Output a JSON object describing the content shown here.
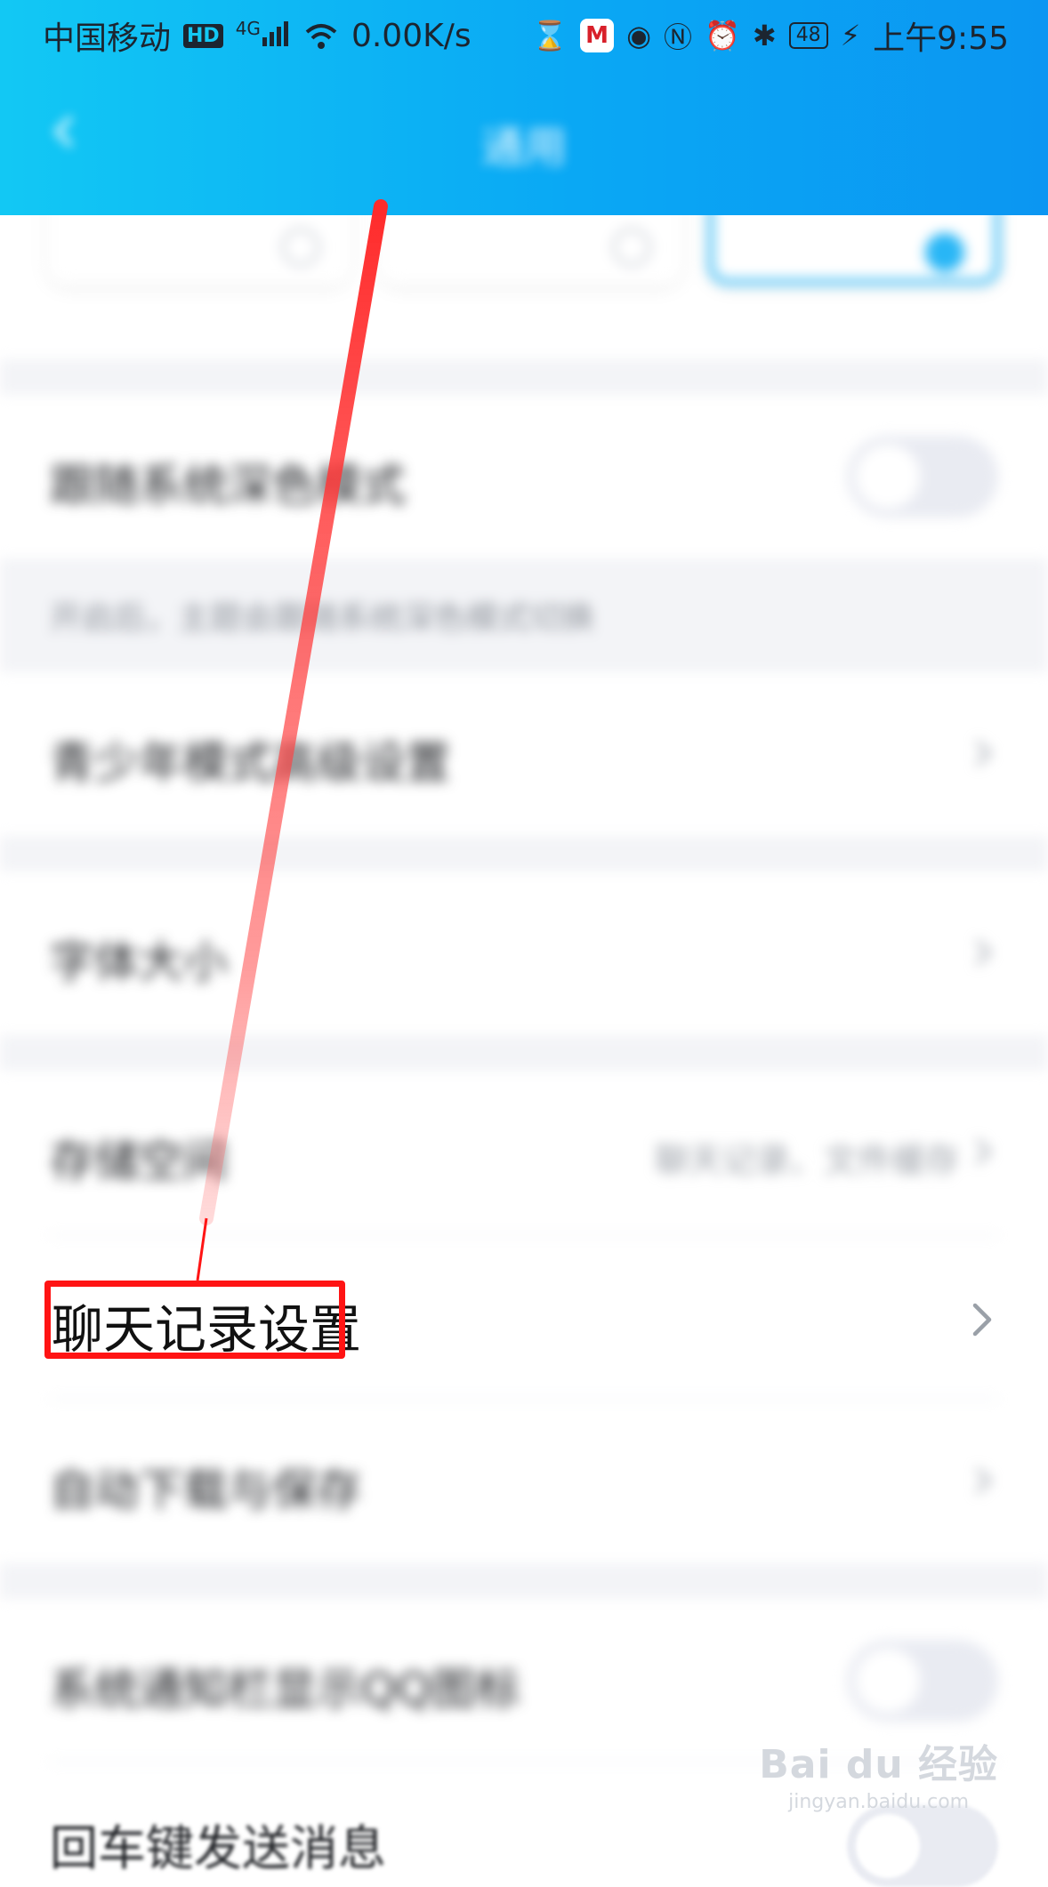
{
  "status_bar": {
    "carrier": "中国移动",
    "hd_badge": "HD",
    "network_type": "4G",
    "net_speed": "0.00K/s",
    "app_icon": "M",
    "battery": "48",
    "time": "上午9:55",
    "icons": [
      "signal-icon",
      "wifi-icon",
      "hourglass-icon",
      "eye-icon",
      "nfc-icon",
      "alarm-icon",
      "bluetooth-icon",
      "battery-icon",
      "charging-icon"
    ]
  },
  "nav": {
    "title": "通用",
    "back_icon": "back-arrow-icon"
  },
  "theme_options": [
    {
      "selected": false
    },
    {
      "selected": false
    },
    {
      "selected": true
    }
  ],
  "settings": {
    "dark_mode_follow": {
      "label": "跟随系统深色模式",
      "toggle": false
    },
    "dark_mode_hint": "开启后，主题会跟随系统深色模式切换",
    "teen_mode": {
      "label": "青少年模式高级设置"
    },
    "font_size": {
      "label": "字体大小"
    },
    "storage": {
      "label": "存储空间",
      "value": "聊天记录、文件缓存"
    },
    "chat_history": {
      "label": "聊天记录设置"
    },
    "auto_download": {
      "label": "自动下载与保存"
    },
    "notification_icon": {
      "label": "系统通知栏显示QQ图标",
      "toggle": false
    },
    "enter_send": {
      "label": "回车键发送消息",
      "toggle": false
    }
  },
  "annotation": {
    "highlight_color": "#ff1414",
    "highlight_target": "chat_history"
  },
  "watermark": {
    "logo": "Bai du 经验",
    "url": "jingyan.baidu.com"
  },
  "colors": {
    "header_start": "#12c8f4",
    "header_end": "#0b96f2",
    "accent": "#28b6f6"
  }
}
